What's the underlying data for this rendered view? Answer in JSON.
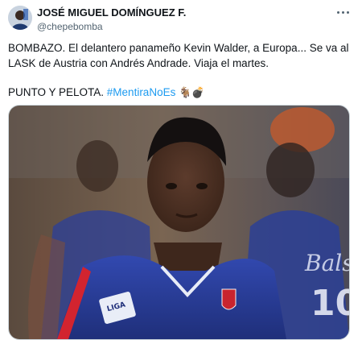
{
  "author": {
    "display_name": "JOSÉ MIGUEL DOMÍNGUEZ F.",
    "handle": "@chepebomba",
    "avatar_icon": "profile-avatar"
  },
  "more_icon": "ellipsis-icon",
  "tweet": {
    "line1": "BOMBAZO. El delantero panameño Kevin Walder, a Europa... Se va al LASK de Austria con Andrés Andrade. Viaja el martes.",
    "line2_prefix": "PUNTO Y PELOTA. ",
    "hashtag": "#MentiraNoEs",
    "emojis": "🐐💣"
  },
  "media": {
    "kind": "photo",
    "jersey_badge_text": "LIGA",
    "jersey_back_text": "Bals",
    "jersey_number": "10"
  },
  "colors": {
    "text": "#0f1419",
    "secondary": "#536471",
    "link": "#1d9bf0",
    "jersey": "#2a3f9e"
  }
}
